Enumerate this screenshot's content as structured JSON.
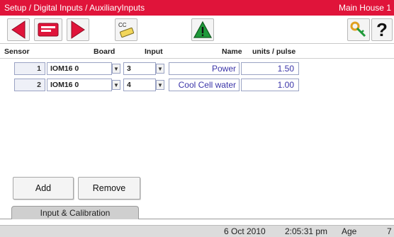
{
  "window": {
    "breadcrumb": "Setup / Digital Inputs / AuxiliaryInputs",
    "location": "Main House 1"
  },
  "toolbar": {
    "cc_label": "CC",
    "help_label": "?",
    "icons": [
      "arrow-left-icon",
      "ticket-icon",
      "arrow-right-icon",
      "calibration-icon",
      "warning-icon",
      "key-icon",
      "help-icon"
    ]
  },
  "table": {
    "headers": {
      "sensor": "Sensor",
      "board": "Board",
      "input": "Input",
      "name": "Name",
      "units": "units / pulse"
    },
    "rows": [
      {
        "sensor": "1",
        "board": "IOM16 0",
        "input": "3",
        "name": "Power",
        "units": "1.50"
      },
      {
        "sensor": "2",
        "board": "IOM16 0",
        "input": "4",
        "name": "Cool Cell water",
        "units": "1.00"
      }
    ]
  },
  "actions": {
    "add": "Add",
    "remove": "Remove"
  },
  "tabs": {
    "active": "Input & Calibration"
  },
  "status": {
    "date": "6 Oct 2010",
    "time": "2:05:31 pm",
    "age_label": "Age",
    "trailing": "7"
  },
  "colors": {
    "titlebar": "#e0143a",
    "arrow": "#e0143a",
    "value_text": "#3a34a8",
    "warning_green": "#1f9a3a"
  }
}
